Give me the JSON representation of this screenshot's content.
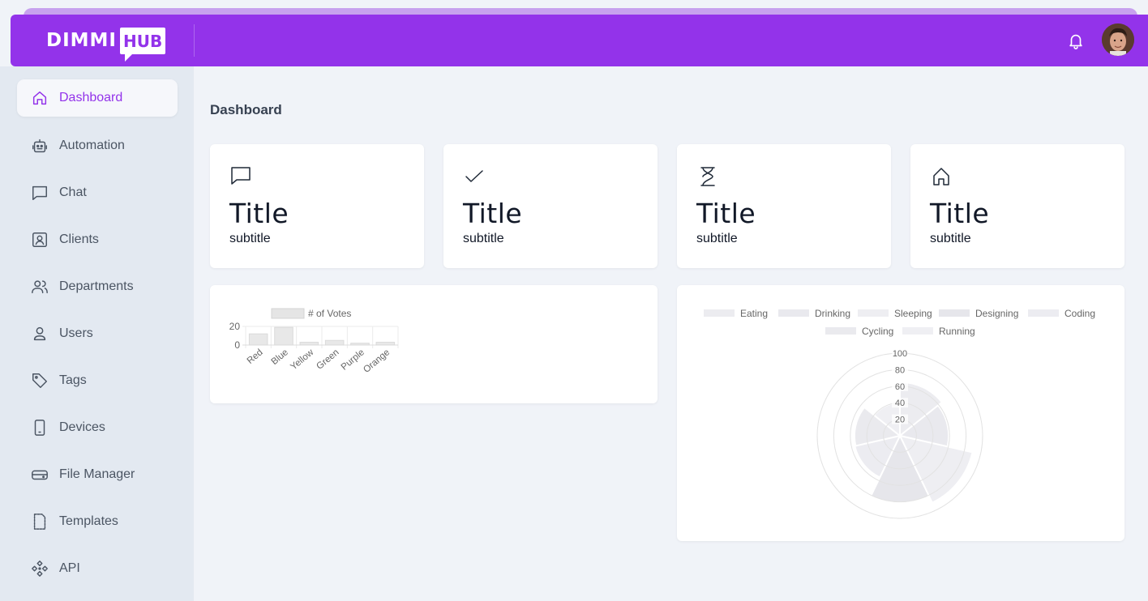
{
  "app": {
    "logo_text": "DIMMI",
    "logo_badge": "HUB"
  },
  "header": {
    "bell_icon": "bell-icon",
    "avatar": "user-avatar"
  },
  "sidebar": {
    "items": [
      {
        "label": "Dashboard",
        "icon": "home-icon",
        "active": true
      },
      {
        "label": "Automation",
        "icon": "robot-icon"
      },
      {
        "label": "Chat",
        "icon": "chat-icon"
      },
      {
        "label": "Clients",
        "icon": "contact-card-icon"
      },
      {
        "label": "Departments",
        "icon": "users-group-icon"
      },
      {
        "label": "Users",
        "icon": "user-icon"
      },
      {
        "label": "Tags",
        "icon": "tag-icon"
      },
      {
        "label": "Devices",
        "icon": "phone-icon"
      },
      {
        "label": "File Manager",
        "icon": "drive-icon"
      },
      {
        "label": "Templates",
        "icon": "file-icon"
      },
      {
        "label": "API",
        "icon": "api-icon"
      }
    ]
  },
  "main": {
    "page_title": "Dashboard",
    "stats": [
      {
        "icon": "chat-icon",
        "title": "Title",
        "subtitle": "subtitle"
      },
      {
        "icon": "check-icon",
        "title": "Title",
        "subtitle": "subtitle"
      },
      {
        "icon": "hourglass-icon",
        "title": "Title",
        "subtitle": "subtitle"
      },
      {
        "icon": "home-icon",
        "title": "Title",
        "subtitle": "subtitle"
      }
    ]
  },
  "chart_data": [
    {
      "type": "bar",
      "categories": [
        "Red",
        "Blue",
        "Yellow",
        "Green",
        "Purple",
        "Orange"
      ],
      "series": [
        {
          "name": "# of Votes",
          "values": [
            12,
            19,
            3,
            5,
            2,
            3
          ]
        }
      ],
      "ylim": [
        0,
        20
      ],
      "yticks": [
        "20",
        "0"
      ],
      "legend": "top",
      "grid": true
    },
    {
      "type": "polarArea",
      "categories": [
        "Eating",
        "Drinking",
        "Sleeping",
        "Designing",
        "Coding",
        "Cycling",
        "Running"
      ],
      "values": [
        65,
        59,
        90,
        81,
        56,
        55,
        40
      ],
      "rlim": [
        0,
        100
      ],
      "rticks": [
        "20",
        "40",
        "60",
        "80",
        "100"
      ],
      "legend": "top"
    }
  ],
  "colors": {
    "accent": "#9333ea",
    "header": "#9333ea",
    "sidebar_bg": "#e3e9f1",
    "page_bg": "#f0f3f8"
  }
}
